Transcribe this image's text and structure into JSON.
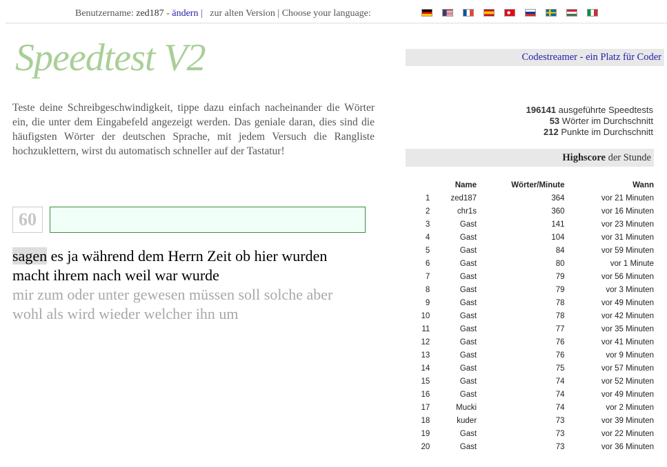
{
  "topbar": {
    "username_label": "Benutzername:",
    "username": "zed187",
    "dash": "-",
    "change_link": "ändern",
    "pipe1": "|",
    "old_version_link": "zur alten Version",
    "pipe2": "|",
    "language_label": "Choose your language:",
    "flags": [
      "flag-de-icon",
      "flag-us-icon",
      "flag-fr-icon",
      "flag-es-icon",
      "flag-tr-icon",
      "flag-ru-icon",
      "flag-se-icon",
      "flag-hu-icon",
      "flag-it-icon"
    ]
  },
  "logo": "Speedtest V2",
  "intro": "Teste deine Schreibgeschwindigkeit, tippe dazu einfach nacheinander die Wörter ein, die unter dem Eingabefeld angezeigt werden. Das geniale daran, dies sind die häufigsten Wörter der deutschen Sprache, mit jedem Versuch die Rangliste hochzuklettern, wirst du automatisch schneller auf der Tastatur!",
  "timer": "60",
  "typing_input": {
    "value": ""
  },
  "words": {
    "current": "sagen",
    "line1_rest": "es ja während dem Herrn Zeit ob hier wurden",
    "line2": "macht ihrem nach weil war wurde",
    "line3": "mir zum oder unter gewesen müssen soll solche aber",
    "line4": "wohl als wird wieder welcher ihn um"
  },
  "right_header_link": "Codestreamer - ein Platz für Coder",
  "stats": {
    "tests_count": "196141",
    "tests_label": "ausgeführte Speedtests",
    "avg_words": "53",
    "avg_words_label": "Wörter im Durchschnitt",
    "avg_points": "212",
    "avg_points_label": "Punkte im Durchschnitt"
  },
  "highscore": {
    "title_bold": "Highscore",
    "title_rest": "der Stunde",
    "headers": [
      "",
      "Name",
      "Wörter/Minute",
      "Wann"
    ],
    "rows": [
      [
        "1",
        "zed187",
        "364",
        "vor 21 Minuten"
      ],
      [
        "2",
        "chr1s",
        "360",
        "vor 16 Minuten"
      ],
      [
        "3",
        "Gast",
        "141",
        "vor 23 Minuten"
      ],
      [
        "4",
        "Gast",
        "104",
        "vor 31 Minuten"
      ],
      [
        "5",
        "Gast",
        "84",
        "vor 59 Minuten"
      ],
      [
        "6",
        "Gast",
        "80",
        "vor 1 Minute"
      ],
      [
        "7",
        "Gast",
        "79",
        "vor 56 Minuten"
      ],
      [
        "8",
        "Gast",
        "79",
        "vor 3 Minuten"
      ],
      [
        "9",
        "Gast",
        "78",
        "vor 49 Minuten"
      ],
      [
        "10",
        "Gast",
        "78",
        "vor 42 Minuten"
      ],
      [
        "11",
        "Gast",
        "77",
        "vor 35 Minuten"
      ],
      [
        "12",
        "Gast",
        "76",
        "vor 41 Minuten"
      ],
      [
        "13",
        "Gast",
        "76",
        "vor 9 Minuten"
      ],
      [
        "14",
        "Gast",
        "75",
        "vor 57 Minuten"
      ],
      [
        "15",
        "Gast",
        "74",
        "vor 52 Minuten"
      ],
      [
        "16",
        "Gast",
        "74",
        "vor 49 Minuten"
      ],
      [
        "17",
        "Mucki",
        "74",
        "vor 2 Minuten"
      ],
      [
        "18",
        "kuder",
        "73",
        "vor 39 Minuten"
      ],
      [
        "19",
        "Gast",
        "73",
        "vor 22 Minuten"
      ],
      [
        "20",
        "Gast",
        "73",
        "vor 36 Minuten"
      ]
    ]
  }
}
